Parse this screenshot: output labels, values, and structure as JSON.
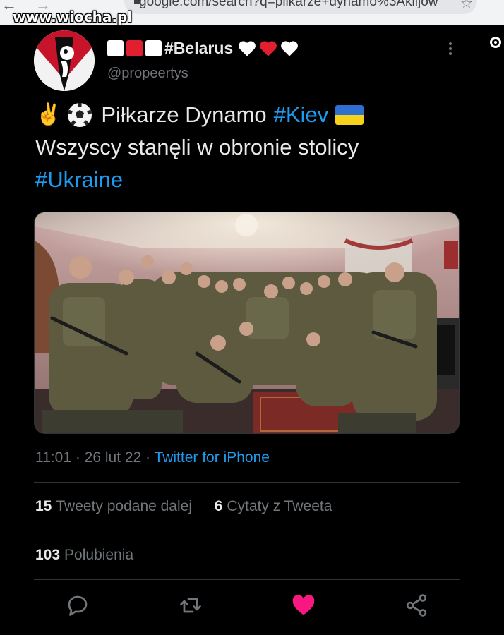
{
  "browser": {
    "url": "google.com/search?q=pilkarze+dynamo%3Aklijow",
    "watermark": "www.wiocha.pl"
  },
  "tweet": {
    "display_name_tag": "#Belarus",
    "handle": "@propeertys",
    "text_line1_prefix": "Piłkarze Dynamo",
    "hashtag_kiev": "#Kiev",
    "text_line2": "Wszyscy stanęli w obronie stolicy",
    "hashtag_ukraine": "#Ukraine",
    "time": "11:01",
    "date": "26 lut 22",
    "source": "Twitter for iPhone",
    "retweets_count": "15",
    "retweets_label": "Tweety podane dalej",
    "quotes_count": "6",
    "quotes_label": "Cytaty z Tweeta",
    "likes_count": "103",
    "likes_label": "Polubienia",
    "liked": true
  },
  "icons": {
    "emoji_hand": "✌️",
    "reply": "reply-icon",
    "retweet": "retweet-icon",
    "like": "heart-icon",
    "share": "share-icon",
    "more": "more-icon"
  },
  "colors": {
    "background": "#000000",
    "text": "#e7e9ea",
    "muted": "#71767b",
    "link": "#1d9bf0",
    "like": "#f91880",
    "flag_red": "#e0202e",
    "ukraine_blue": "#2f6fcf",
    "ukraine_yellow": "#f7d21a"
  }
}
